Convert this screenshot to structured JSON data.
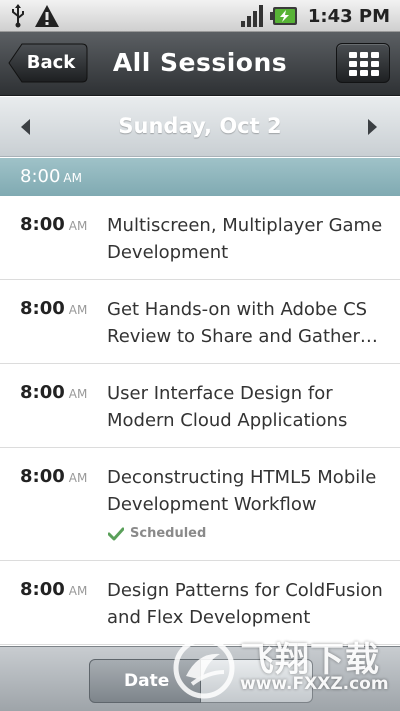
{
  "status_bar": {
    "time": "1:43 PM",
    "icons": [
      "usb-icon",
      "warning-icon",
      "signal-icon",
      "battery-charging-icon"
    ]
  },
  "header": {
    "back_label": "Back",
    "title": "All Sessions",
    "menu_icon": "grid-icon"
  },
  "date_nav": {
    "date": "Sunday, Oct 2",
    "prev_icon": "chevron-left-icon",
    "next_icon": "chevron-right-icon"
  },
  "section": {
    "time": "8:00",
    "ampm": "AM"
  },
  "sessions": [
    {
      "time": "8:00",
      "ampm": "AM",
      "title": "Multiscreen, Multiplayer Game Development"
    },
    {
      "time": "8:00",
      "ampm": "AM",
      "title": "Get Hands-on with Adobe CS Review to Share and Gather…"
    },
    {
      "time": "8:00",
      "ampm": "AM",
      "title": "User Interface Design for Modern Cloud Applications"
    },
    {
      "time": "8:00",
      "ampm": "AM",
      "title": "Deconstructing HTML5 Mobile Development Workflow",
      "status": "Scheduled"
    },
    {
      "time": "8:00",
      "ampm": "AM",
      "title": "Design Patterns for ColdFusion and Flex Development"
    }
  ],
  "bottom_bar": {
    "date_tab_label": "Date"
  },
  "watermark": {
    "text": "飞翔下载",
    "url": "www.FXXZ.com"
  },
  "colors": {
    "action_bar": "#3f4347",
    "section_header": "#8fb6bd",
    "scheduled_check": "#5aa05a"
  }
}
